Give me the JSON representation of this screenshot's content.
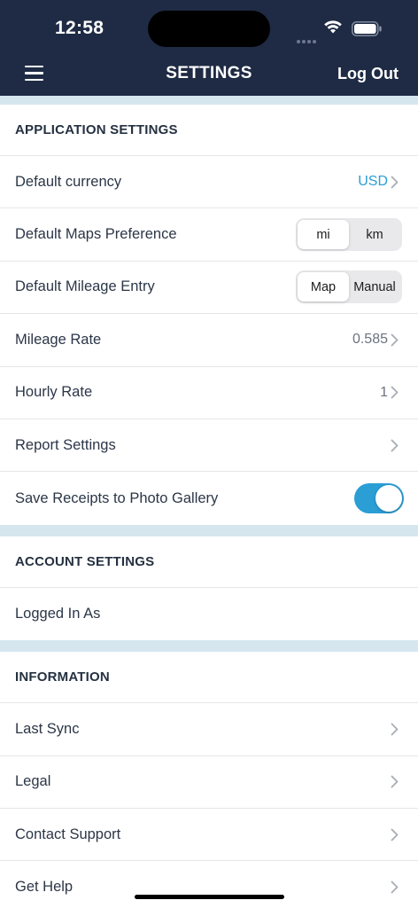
{
  "status_bar": {
    "time": "12:58"
  },
  "nav": {
    "title": "SETTINGS",
    "logout_label": "Log Out"
  },
  "application_settings": {
    "header": "APPLICATION SETTINGS",
    "default_currency": {
      "label": "Default currency",
      "value": "USD"
    },
    "maps_preference": {
      "label": "Default Maps Preference",
      "options": [
        "mi",
        "km"
      ],
      "selected": "mi"
    },
    "mileage_entry": {
      "label": "Default Mileage Entry",
      "options": [
        "Map",
        "Manual"
      ],
      "selected": "Map"
    },
    "mileage_rate": {
      "label": "Mileage Rate",
      "value": "0.585"
    },
    "hourly_rate": {
      "label": "Hourly Rate",
      "value": "1"
    },
    "report_settings": {
      "label": "Report Settings"
    },
    "save_receipts": {
      "label": "Save Receipts to Photo Gallery",
      "enabled": true
    }
  },
  "account_settings": {
    "header": "ACCOUNT SETTINGS",
    "logged_in_as": {
      "label": "Logged In As"
    }
  },
  "information": {
    "header": "INFORMATION",
    "last_sync": {
      "label": "Last Sync"
    },
    "legal": {
      "label": "Legal"
    },
    "contact_support": {
      "label": "Contact Support"
    },
    "get_help": {
      "label": "Get Help"
    }
  },
  "colors": {
    "nav_bg": "#1f2b44",
    "accent": "#2b9ed6",
    "section_gap": "#d6e6ef"
  }
}
